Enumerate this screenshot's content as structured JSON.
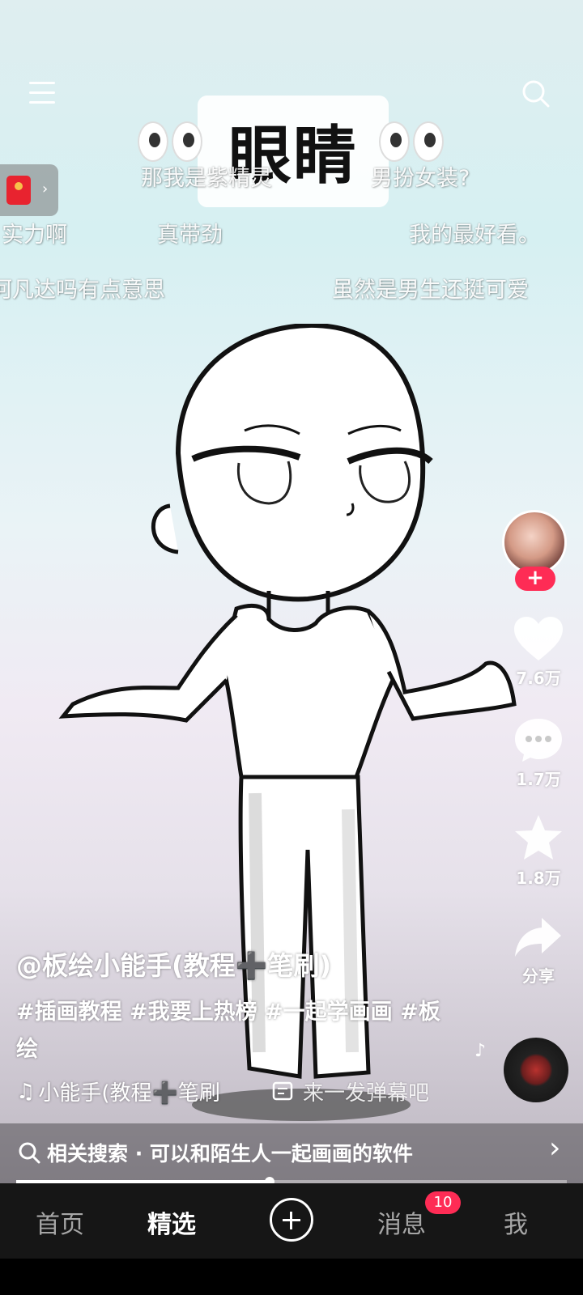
{
  "video": {
    "title_card": "眼睛",
    "danmaku": [
      "那我是紫精灵",
      "男扮女装?",
      "实力啊",
      "真带劲",
      "我的最好看。",
      "河凡达吗有点意思",
      "虽然是男生还挺可爱"
    ],
    "progress": 0.46
  },
  "top": {
    "menu_icon": "menu-icon",
    "search_icon": "search-icon"
  },
  "red_packet": {
    "icon": "red-packet-icon",
    "chevron": "›"
  },
  "actions": {
    "follow_label": "+",
    "likes": "7.6万",
    "comments": "1.7万",
    "favorites": "1.8万",
    "share": "分享"
  },
  "post": {
    "author": "@板绘小能手(教程➕笔刷)",
    "description": "#插画教程 #我要上热榜 #一起学画画 #板绘",
    "music": "小能手(教程➕笔刷",
    "danmaku_prompt": "来一发弹幕吧"
  },
  "related_search": {
    "label": "相关搜索 · 可以和陌生人一起画画的软件",
    "chevron": "›"
  },
  "tabbar": {
    "home": "首页",
    "featured": "精选",
    "messages": "消息",
    "messages_badge": "10",
    "me": "我"
  },
  "colors": {
    "accent": "#fe2c55",
    "tabbar_bg": "#161616"
  }
}
